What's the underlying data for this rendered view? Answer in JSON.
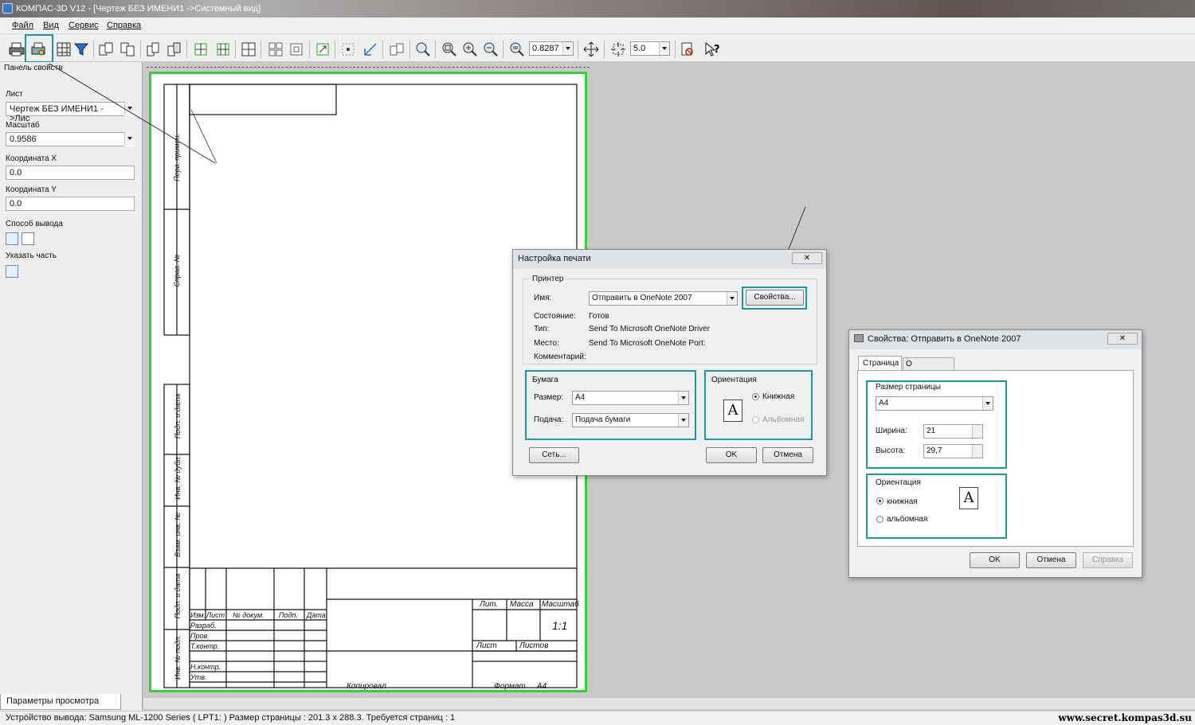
{
  "window": {
    "title": "КОМПАС-3D V12 - [Чертеж БЕЗ ИМЕНИ1 ->Системный вид]"
  },
  "menu": [
    "Файл",
    "Вид",
    "Сервис",
    "Справка"
  ],
  "toolbar": {
    "scale_value": "0.8287",
    "step_value": "5.0"
  },
  "left_panel": {
    "title": "Панель свойств",
    "sheet_label": "Лист",
    "sheet_value": "Чертеж БЕЗ ИМЕНИ1 ->Лис",
    "scale_label": "Масштаб",
    "scale_value": "0.9586",
    "x_label": "Координата X",
    "x_value": "0.0",
    "y_label": "Координата Y",
    "y_value": "0.0",
    "output_label": "Способ вывода",
    "part_label": "Указать часть",
    "bottom_tab": "Параметры просмотра"
  },
  "drawing": {
    "side_labels": [
      "Перв. примен.",
      "Справ. №",
      "Подп. и дата",
      "Инв. № дубл.",
      "Взам. инв. №",
      "Подп. и дата",
      "Инв. № подл."
    ],
    "stamp_headers": [
      "Изм.",
      "Лист",
      "№ докум.",
      "Подп.",
      "Дата"
    ],
    "stamp_rows": [
      "Разраб.",
      "Пров.",
      "Т.контр.",
      "Н.контр.",
      "Утв."
    ],
    "lit": "Лит.",
    "mass": "Масса",
    "scale_hdr": "Масштаб",
    "scale_val": "1:1",
    "sheet": "Лист",
    "sheets": "Листов",
    "copied": "Копировал",
    "format": "Формат",
    "format_val": "A4"
  },
  "print_dialog": {
    "title": "Настройка печати",
    "printer_group": "Принтер",
    "name_label": "Имя:",
    "name_value": "Отправить в OneNote 2007",
    "properties_button": "Свойства...",
    "state_label": "Состояние:",
    "state_value": "Готов",
    "type_label": "Тип:",
    "type_value": "Send To Microsoft OneNote Driver",
    "place_label": "Место:",
    "place_value": "Send To Microsoft OneNote Port:",
    "comment_label": "Комментарий:",
    "paper_group": "Бумага",
    "size_label": "Размер:",
    "size_value": "A4",
    "feed_label": "Подача:",
    "feed_value": "Подача бумаги",
    "orientation_group": "Ориентация",
    "portrait": "Книжная",
    "landscape": "Альбомная",
    "network_button": "Сеть...",
    "ok_button": "OK",
    "cancel_button": "Отмена"
  },
  "props_dialog": {
    "title": "Свойства: Отправить в OneNote 2007",
    "tab_page": "Страница",
    "tab_about": "О программе",
    "page_size_group": "Размер страницы",
    "size_value": "A4",
    "width_label": "Ширина:",
    "width_value": "21",
    "height_label": "Высота:",
    "height_value": "29,7",
    "orientation_group": "Ориентация",
    "portrait": "книжная",
    "landscape": "альбомная",
    "ok_button": "OK",
    "cancel_button": "Отмена",
    "help_button": "Справка"
  },
  "status": {
    "text": "Устройство вывода: Samsung ML-1200 Series ( LPT1: )  Размер страницы : 201.3 x 288.3.  Требуется страниц : 1"
  },
  "watermark": "www.secret.kompas3d.su",
  "colors": {
    "highlight": "#1a9a9a",
    "sheet_border": "#3bd03b"
  }
}
